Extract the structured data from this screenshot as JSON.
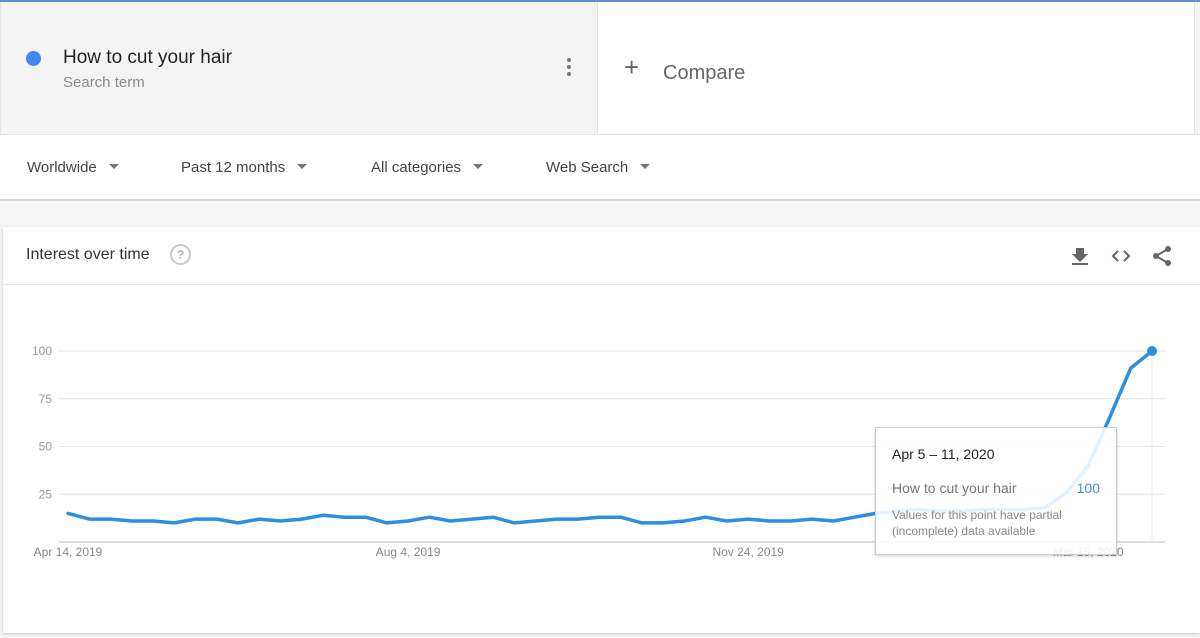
{
  "search_term": {
    "title": "How to cut your hair",
    "subtitle": "Search term",
    "color": "#4285f4"
  },
  "compare": {
    "label": "Compare",
    "icon": "plus-icon"
  },
  "filters": [
    {
      "label": "Worldwide"
    },
    {
      "label": "Past 12 months"
    },
    {
      "label": "All categories"
    },
    {
      "label": "Web Search"
    }
  ],
  "card": {
    "title": "Interest over time",
    "help_icon": "?",
    "actions": [
      "download-icon",
      "embed-code-icon",
      "share-icon"
    ]
  },
  "tooltip": {
    "date": "Apr 5 – 11, 2020",
    "term": "How to cut your hair",
    "value": "100",
    "note": "Values for this point have partial (incomplete) data available"
  },
  "chart_data": {
    "type": "line",
    "title": "Interest over time",
    "xlabel": "",
    "ylabel": "",
    "ylim": [
      0,
      100
    ],
    "yticks": [
      25,
      50,
      75,
      100
    ],
    "xtick_labels": [
      {
        "label": "Apr 14, 2019",
        "index": 0
      },
      {
        "label": "Aug 4, 2019",
        "index": 16
      },
      {
        "label": "Nov 24, 2019",
        "index": 32
      },
      {
        "label": "Mar 15, 2020",
        "index": 48
      }
    ],
    "grid": true,
    "legend": "none",
    "line_color": "#2d8fe0",
    "series": [
      {
        "name": "How to cut your hair",
        "values": [
          15,
          12,
          12,
          11,
          11,
          10,
          12,
          12,
          10,
          12,
          11,
          12,
          14,
          13,
          13,
          10,
          11,
          13,
          11,
          12,
          13,
          10,
          11,
          12,
          12,
          13,
          13,
          10,
          10,
          11,
          13,
          11,
          12,
          11,
          11,
          12,
          11,
          13,
          15,
          16,
          17,
          16,
          16,
          17,
          17,
          17,
          18,
          26,
          40,
          65,
          91,
          100
        ]
      }
    ],
    "highlighted_point": {
      "index": 51,
      "label": "Apr 5 – 11, 2020",
      "value": 100,
      "partial": true
    }
  }
}
